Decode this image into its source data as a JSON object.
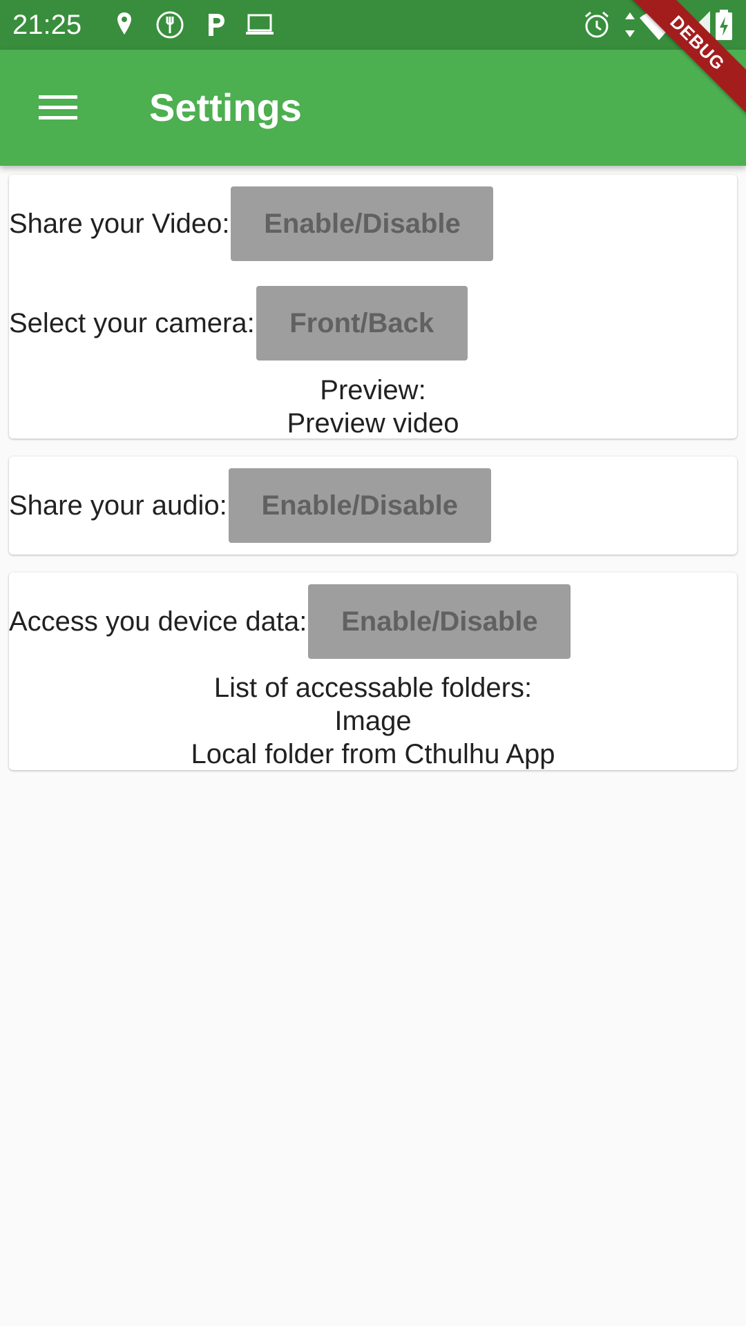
{
  "status_bar": {
    "time": "21:25",
    "left_icons": [
      "location-pin-icon",
      "restaurant-icon",
      "parking-icon",
      "laptop-icon"
    ],
    "right_icons": [
      "alarm-icon",
      "data-arrows-icon",
      "wifi-icon",
      "signal-icon",
      "battery-charging-icon"
    ]
  },
  "app_bar": {
    "title": "Settings",
    "menu_icon": "hamburger-menu-icon",
    "color": "#4caf50"
  },
  "debug_banner": "DEBUG",
  "video_card": {
    "share_label": "Share your Video:",
    "share_button": "Enable/Disable",
    "camera_label": "Select your camera:",
    "camera_button": "Front/Back",
    "preview_title": "Preview:",
    "preview_text": "Preview video"
  },
  "audio_card": {
    "share_label": "Share your audio:",
    "share_button": "Enable/Disable"
  },
  "data_card": {
    "access_label": "Access you device data:",
    "access_button": "Enable/Disable",
    "folders_title": "List of accessable folders:",
    "folders": [
      "Image",
      "Local folder from Cthulhu App"
    ]
  },
  "colors": {
    "status_bar": "#388e3c",
    "button": "#9e9e9e",
    "button_text": "#616161",
    "debug": "#a31d1d"
  }
}
